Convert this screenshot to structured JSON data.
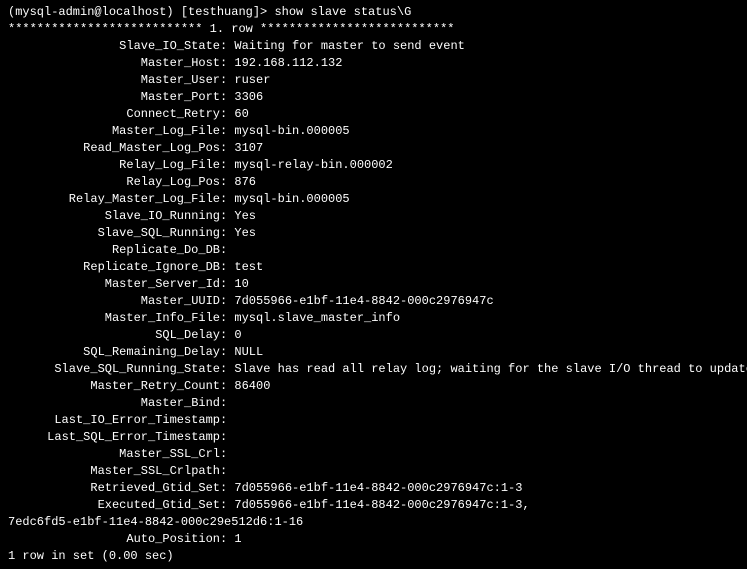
{
  "prompt": "(mysql-admin@localhost) [testhuang]> show slave status\\G",
  "row_header": "*************************** 1. row ***************************",
  "fields": [
    {
      "label": "Slave_IO_State",
      "value": "Waiting for master to send event"
    },
    {
      "label": "Master_Host",
      "value": "192.168.112.132"
    },
    {
      "label": "Master_User",
      "value": "ruser"
    },
    {
      "label": "Master_Port",
      "value": "3306"
    },
    {
      "label": "Connect_Retry",
      "value": "60"
    },
    {
      "label": "Master_Log_File",
      "value": "mysql-bin.000005"
    },
    {
      "label": "Read_Master_Log_Pos",
      "value": "3107"
    },
    {
      "label": "Relay_Log_File",
      "value": "mysql-relay-bin.000002"
    },
    {
      "label": "Relay_Log_Pos",
      "value": "876"
    },
    {
      "label": "Relay_Master_Log_File",
      "value": "mysql-bin.000005"
    },
    {
      "label": "Slave_IO_Running",
      "value": "Yes"
    },
    {
      "label": "Slave_SQL_Running",
      "value": "Yes"
    },
    {
      "label": "Replicate_Do_DB",
      "value": ""
    },
    {
      "label": "Replicate_Ignore_DB",
      "value": "test"
    },
    {
      "label": "Master_Server_Id",
      "value": "10"
    },
    {
      "label": "Master_UUID",
      "value": "7d055966-e1bf-11e4-8842-000c2976947c"
    },
    {
      "label": "Master_Info_File",
      "value": "mysql.slave_master_info"
    },
    {
      "label": "SQL_Delay",
      "value": "0"
    },
    {
      "label": "SQL_Remaining_Delay",
      "value": "NULL"
    },
    {
      "label": "Slave_SQL_Running_State",
      "value": "Slave has read all relay log; waiting for the slave I/O thread to update it"
    },
    {
      "label": "Master_Retry_Count",
      "value": "86400"
    },
    {
      "label": "Master_Bind",
      "value": ""
    },
    {
      "label": "Last_IO_Error_Timestamp",
      "value": ""
    },
    {
      "label": "Last_SQL_Error_Timestamp",
      "value": ""
    },
    {
      "label": "Master_SSL_Crl",
      "value": ""
    },
    {
      "label": "Master_SSL_Crlpath",
      "value": ""
    },
    {
      "label": "Retrieved_Gtid_Set",
      "value": "7d055966-e1bf-11e4-8842-000c2976947c:1-3"
    },
    {
      "label": "Executed_Gtid_Set",
      "value": "7d055966-e1bf-11e4-8842-000c2976947c:1-3,"
    }
  ],
  "executed_gtid_cont": "7edc6fd5-e1bf-11e4-8842-000c29e512d6:1-16",
  "auto_position": {
    "label": "Auto_Position",
    "value": "1"
  },
  "footer": "1 row in set (0.00 sec)"
}
